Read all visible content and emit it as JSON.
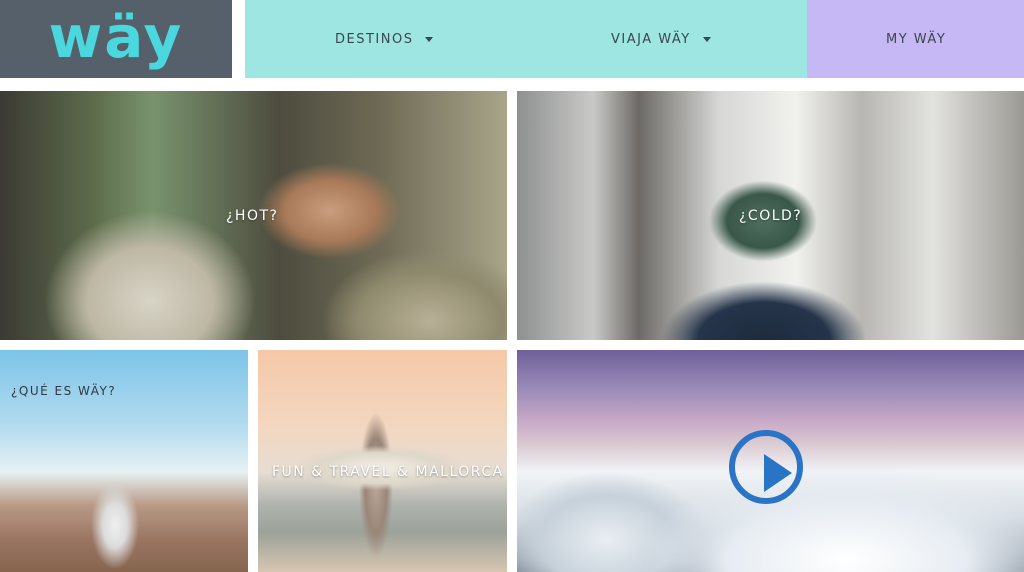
{
  "header": {
    "logo": "wäy",
    "nav": [
      {
        "label": "DESTINOS",
        "has_dropdown": true
      },
      {
        "label": "VIAJA WÄY",
        "has_dropdown": true
      },
      {
        "label": "MY WÄY",
        "has_dropdown": false
      }
    ],
    "colors": {
      "logo_bg": "#56606b",
      "logo_text": "#4ad7de",
      "nav_bg": "#9ee6e2",
      "nav_highlight_bg": "#c5b8f5"
    }
  },
  "tiles": {
    "hot": {
      "label": "¿HOT?"
    },
    "cold": {
      "label": "¿COLD?"
    },
    "que": {
      "label": "¿QUÉ ES WÄY?"
    },
    "fun": {
      "label": "FUN & TRAVEL & MALLORCA"
    },
    "mountain": {
      "label": "",
      "play_icon": "play-icon",
      "play_color": "#2a74c5"
    }
  }
}
